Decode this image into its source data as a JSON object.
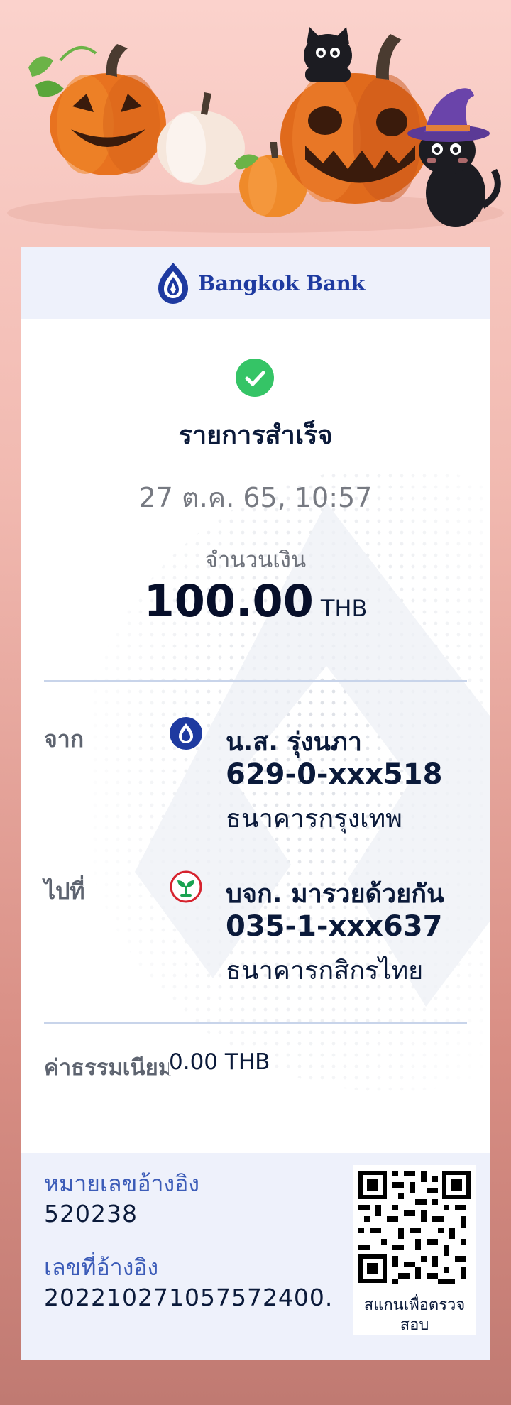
{
  "banner": {
    "theme": "halloween-pumpkins-black-cats"
  },
  "header": {
    "bank_name": "Bangkok Bank",
    "logo_icon": "bangkok-bank-lotus-icon"
  },
  "transaction": {
    "status": "รายการสำเร็จ",
    "status_icon": "check-circle-icon",
    "datetime": "27 ต.ค. 65, 10:57",
    "amount_label": "จำนวนเงิน",
    "amount": "100.00",
    "currency": "THB"
  },
  "from": {
    "label": "จาก",
    "name": "น.ส. รุ่งนภา",
    "account": "629-0-xxx518",
    "bank": "ธนาคารกรุงเทพ",
    "bank_icon": "bangkok-bank-icon"
  },
  "to": {
    "label": "ไปที่",
    "name": "บจก. มารวยด้วยกัน",
    "account": "035-1-xxx637",
    "bank": "ธนาคารกสิกรไทย",
    "bank_icon": "kasikorn-bank-icon"
  },
  "fee": {
    "label": "ค่าธรรมเนียม",
    "value": "0.00 THB"
  },
  "reference": {
    "ref1_label": "หมายเลขอ้างอิง",
    "ref1_value": "520238",
    "ref2_label": "เลขที่อ้างอิง",
    "ref2_value": "20221027105757240​0."
  },
  "qr": {
    "caption_line1": "สแกนเพื่อตรวจ",
    "caption_line2": "สอบ"
  },
  "colors": {
    "brand_blue": "#1e3aa0",
    "success_green": "#35c466",
    "kbank_green": "#1aa251",
    "kbank_red": "#d6232e",
    "header_bg": "#eef1fb"
  }
}
